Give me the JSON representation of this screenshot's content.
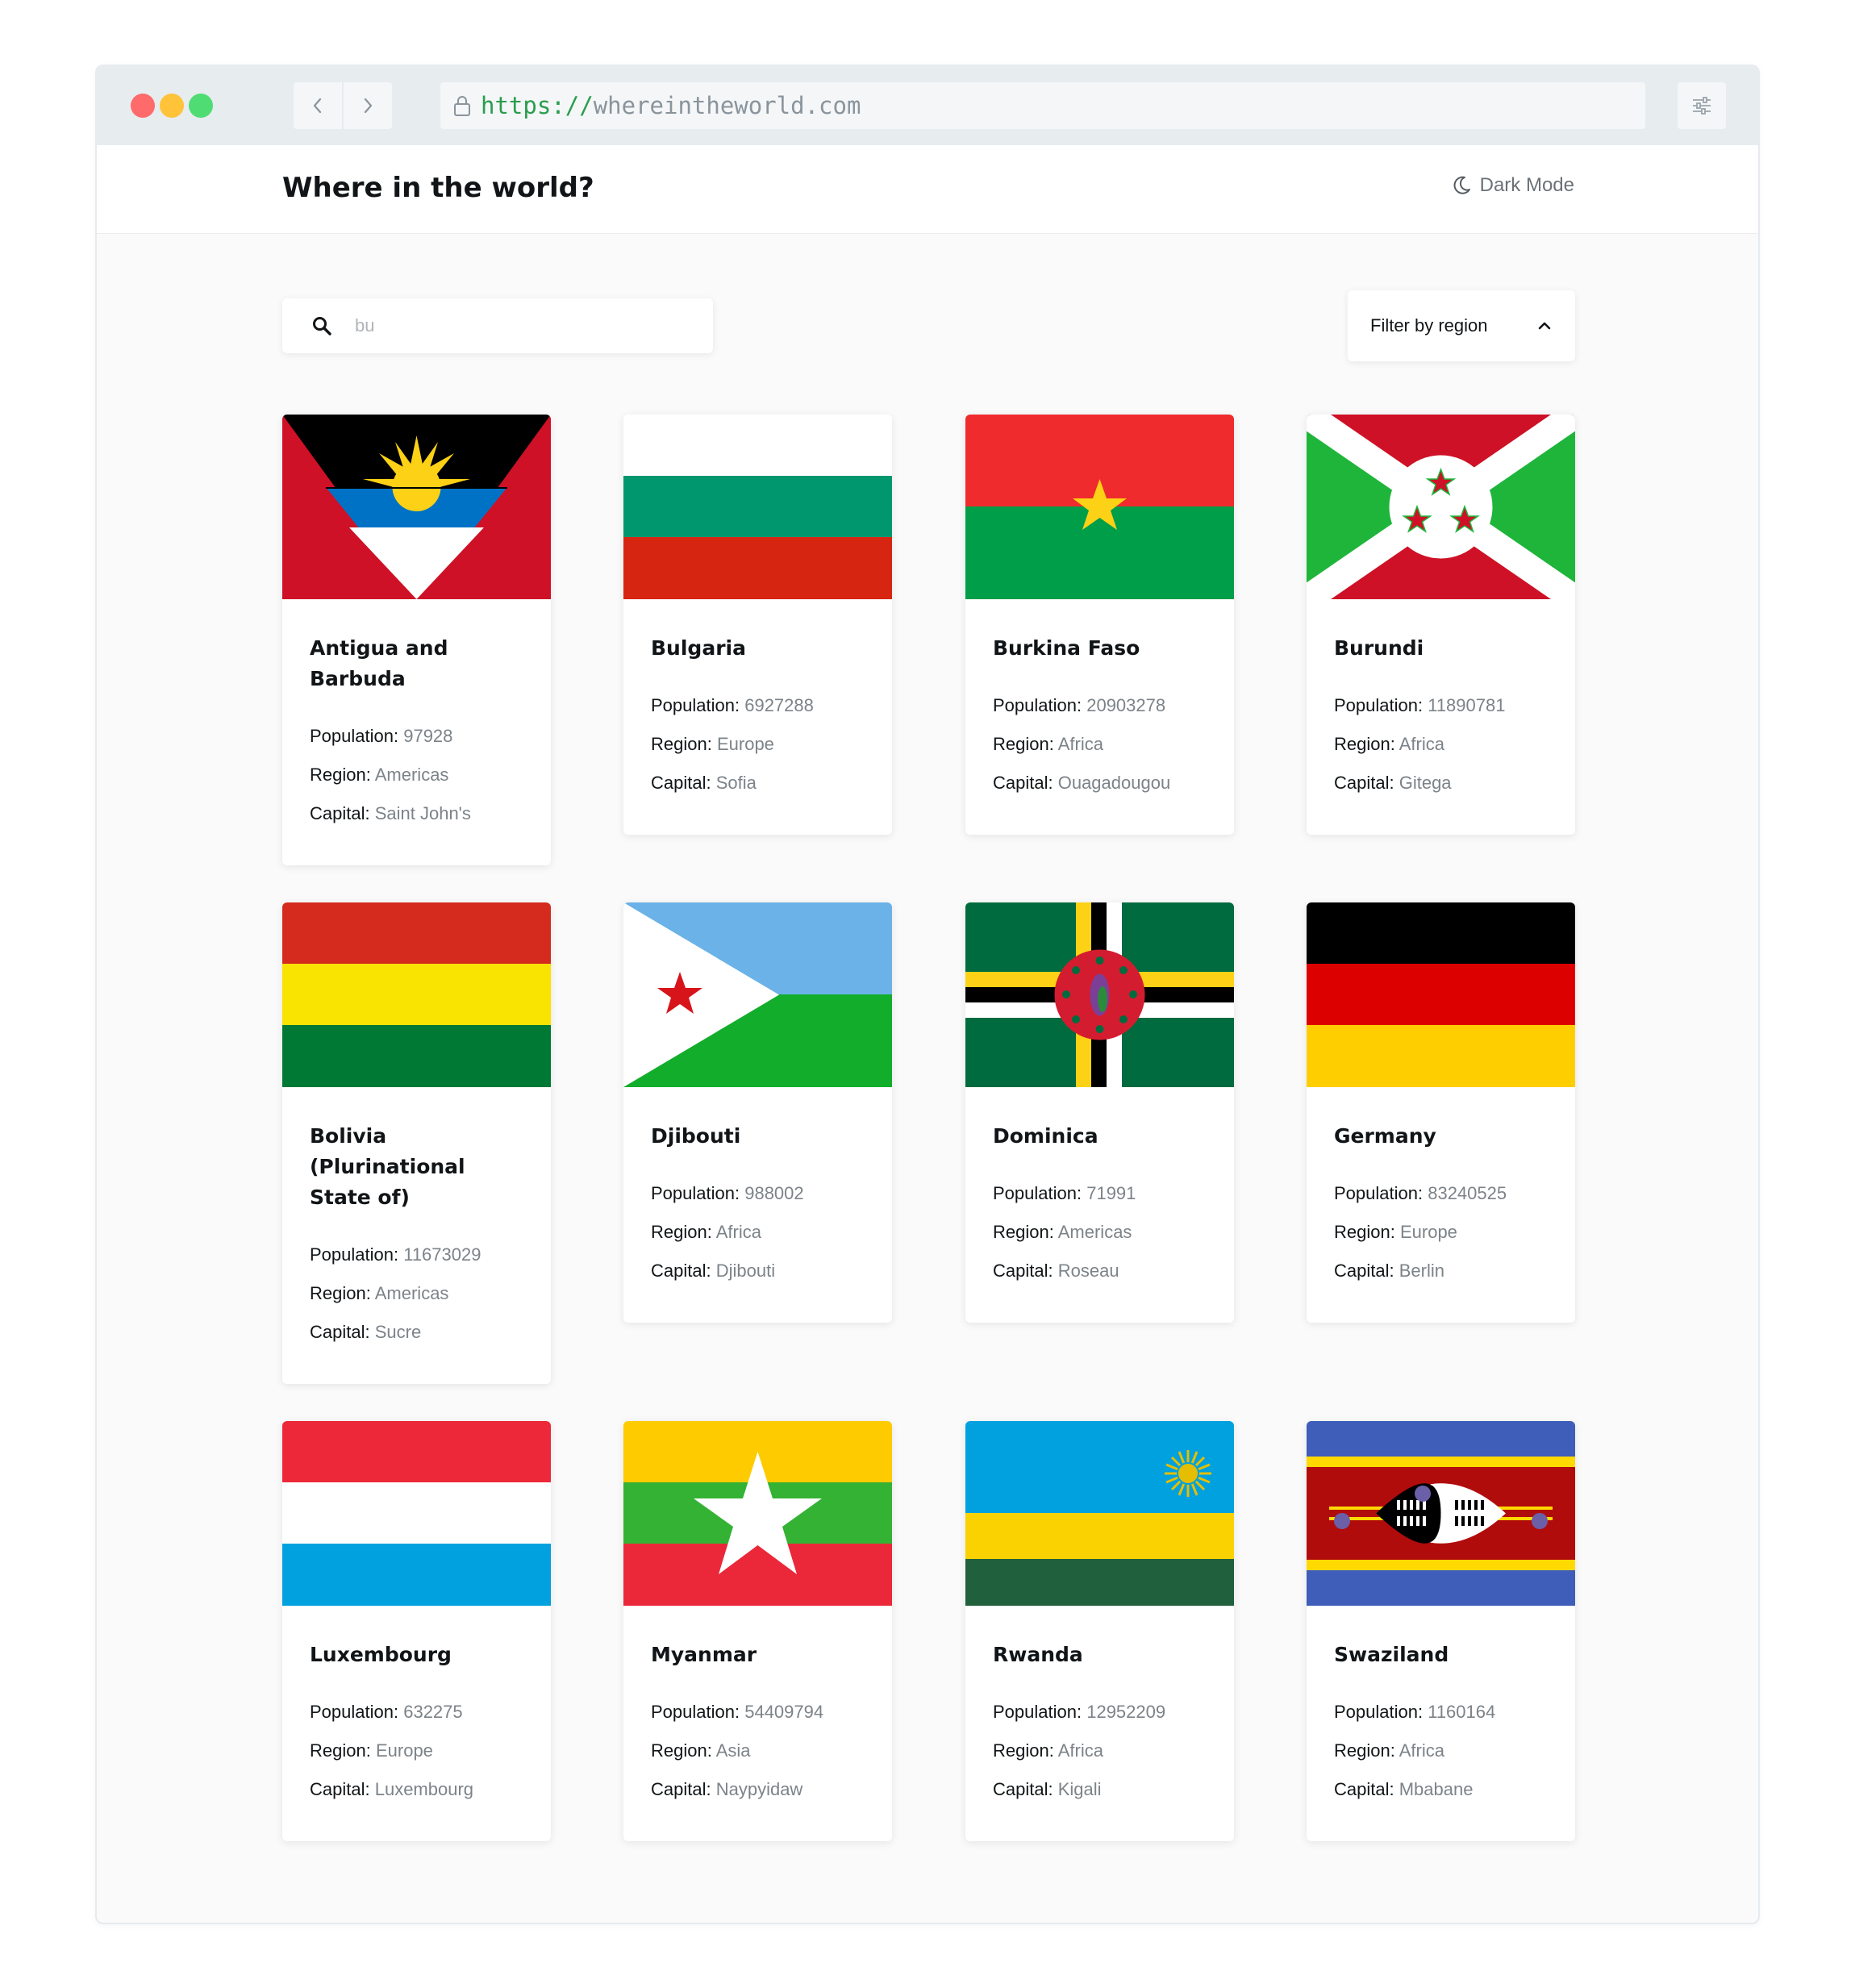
{
  "browser": {
    "url_scheme": "https://",
    "url_host": "whereintheworld.com"
  },
  "header": {
    "title": "Where in the world?",
    "dark_mode_label": "Dark Mode"
  },
  "controls": {
    "search_value": "bu",
    "filter_label": "Filter by region"
  },
  "labels": {
    "population": "Population:",
    "region": "Region:",
    "capital": "Capital:"
  },
  "countries": [
    {
      "name": "Antigua and Barbuda",
      "population": "97928",
      "region": "Americas",
      "capital": "Saint John's",
      "flag": "antigua-and-barbuda-flag"
    },
    {
      "name": "Bulgaria",
      "population": "6927288",
      "region": "Europe",
      "capital": "Sofia",
      "flag": "bulgaria-flag"
    },
    {
      "name": "Burkina Faso",
      "population": "20903278",
      "region": "Africa",
      "capital": "Ouagadougou",
      "flag": "burkina-faso-flag"
    },
    {
      "name": "Burundi",
      "population": "11890781",
      "region": "Africa",
      "capital": "Gitega",
      "flag": "burundi-flag"
    },
    {
      "name": "Bolivia (Plurinational State of)",
      "population": "11673029",
      "region": "Americas",
      "capital": "Sucre",
      "flag": "bolivia-flag"
    },
    {
      "name": "Djibouti",
      "population": "988002",
      "region": "Africa",
      "capital": "Djibouti",
      "flag": "djibouti-flag"
    },
    {
      "name": "Dominica",
      "population": "71991",
      "region": "Americas",
      "capital": "Roseau",
      "flag": "dominica-flag"
    },
    {
      "name": "Germany",
      "population": "83240525",
      "region": "Europe",
      "capital": "Berlin",
      "flag": "germany-flag"
    },
    {
      "name": "Luxembourg",
      "population": "632275",
      "region": "Europe",
      "capital": "Luxembourg",
      "flag": "luxembourg-flag"
    },
    {
      "name": "Myanmar",
      "population": "54409794",
      "region": "Asia",
      "capital": "Naypyidaw",
      "flag": "myanmar-flag"
    },
    {
      "name": "Rwanda",
      "population": "12952209",
      "region": "Africa",
      "capital": "Kigali",
      "flag": "rwanda-flag"
    },
    {
      "name": "Swaziland",
      "population": "1160164",
      "region": "Africa",
      "capital": "Mbabane",
      "flag": "swaziland-flag"
    }
  ]
}
